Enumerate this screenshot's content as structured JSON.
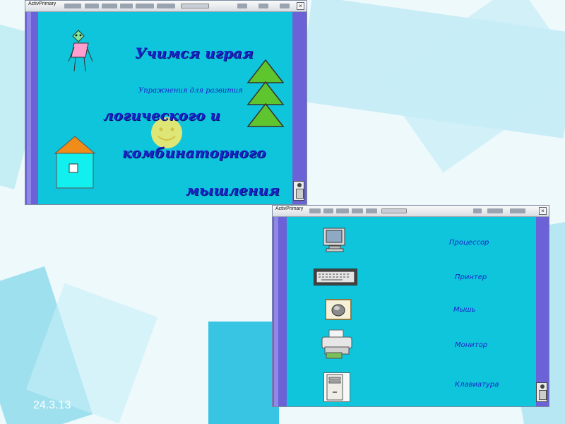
{
  "slide": {
    "date": "24.3.13"
  },
  "top_window": {
    "menu_labels": [
      "ActivPrimary",
      "Ewa"
    ],
    "heading": "Учимся играя",
    "subheading": "Упражнения для развития",
    "line1": "логического и",
    "line2": "комбинаторного",
    "line3": "мышления",
    "icons": [
      "stick-figure-icon",
      "sun-icon",
      "house-icon",
      "triangle-icon",
      "trash-icon"
    ]
  },
  "bottom_window": {
    "menu_labels": [
      "ActivPrimary",
      "Ewa"
    ],
    "items": [
      {
        "label": "Процессор",
        "icon": "monitor-icon"
      },
      {
        "label": "Принтер",
        "icon": "keyboard-icon"
      },
      {
        "label": "Мышь",
        "icon": "mouse-icon"
      },
      {
        "label": "Монитор",
        "icon": "printer-icon"
      },
      {
        "label": "Клавиатура",
        "icon": "system-unit-icon"
      }
    ]
  },
  "colors": {
    "workspace": "#0fc5dc",
    "sidebar": "#6a62d6",
    "text": "#1a23c9",
    "triangle": "#5fc52e",
    "house_roof": "#f08c1a",
    "house_wall": "#11f0ee",
    "sun": "#f5ea6a",
    "figure": "#ff9fd0"
  }
}
